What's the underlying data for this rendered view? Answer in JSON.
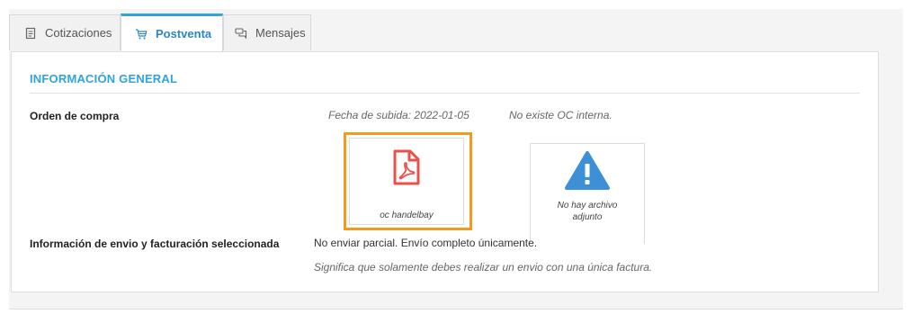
{
  "tabs": [
    {
      "label": "Cotizaciones",
      "icon": "document-icon"
    },
    {
      "label": "Postventa",
      "icon": "cart-icon"
    },
    {
      "label": "Mensajes",
      "icon": "chat-icon"
    }
  ],
  "active_tab": "Postventa",
  "section": {
    "title": "INFORMACIÓN GENERAL"
  },
  "purchase_order": {
    "label": "Orden de compra",
    "upload_date": "Fecha de subida: 2022-01-05",
    "internal_oc_status": "No existe OC interna.",
    "file": {
      "name": "oc handelbay",
      "icon": "pdf-icon"
    },
    "internal_file": {
      "caption_line1": "No hay archivo",
      "caption_line2": "adjunto",
      "icon": "warning-icon"
    }
  },
  "shipping": {
    "label": "Información de envio y facturación seleccionada",
    "value": "No enviar parcial. Envío completo únicamente.",
    "note": "Significa que solamente debes realizar un envio con una única factura."
  },
  "colors": {
    "accent": "#2fa3dd",
    "highlight": "#f39a1e",
    "pdf": "#e9524a",
    "warning": "#3d8fd6"
  }
}
